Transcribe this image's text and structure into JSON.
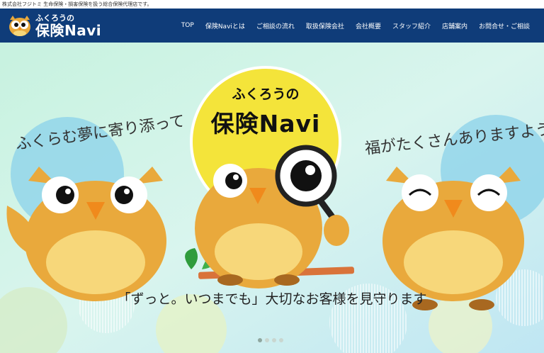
{
  "topbar": {
    "text": "株式会社フジトミ 生命保険・損害保険を扱う総合保険代理店です。"
  },
  "logo": {
    "sub": "ふくろうの",
    "main": "保険Navi"
  },
  "nav": [
    {
      "label": "TOP"
    },
    {
      "label": "保険Naviとは"
    },
    {
      "label": "ご相談の流れ"
    },
    {
      "label": "取扱保険会社"
    },
    {
      "label": "会社概要"
    },
    {
      "label": "スタッフ紹介"
    },
    {
      "label": "店舗案内"
    },
    {
      "label": "お問合せ・ご相談"
    }
  ],
  "hero": {
    "badge_sub": "ふくろうの",
    "badge_main": "保険Navi",
    "arc_left": "ふくらむ夢に寄り添って",
    "arc_right": "福がたくさんありますように",
    "tagline": "「ずっと。いつまでも」大切なお客様を見守ります",
    "slides": 4,
    "active_slide": 0
  },
  "colors": {
    "header": "#0f3c79",
    "owl_body": "#e9a93c",
    "owl_belly": "#f7d77a",
    "badge": "#f4e43a"
  }
}
